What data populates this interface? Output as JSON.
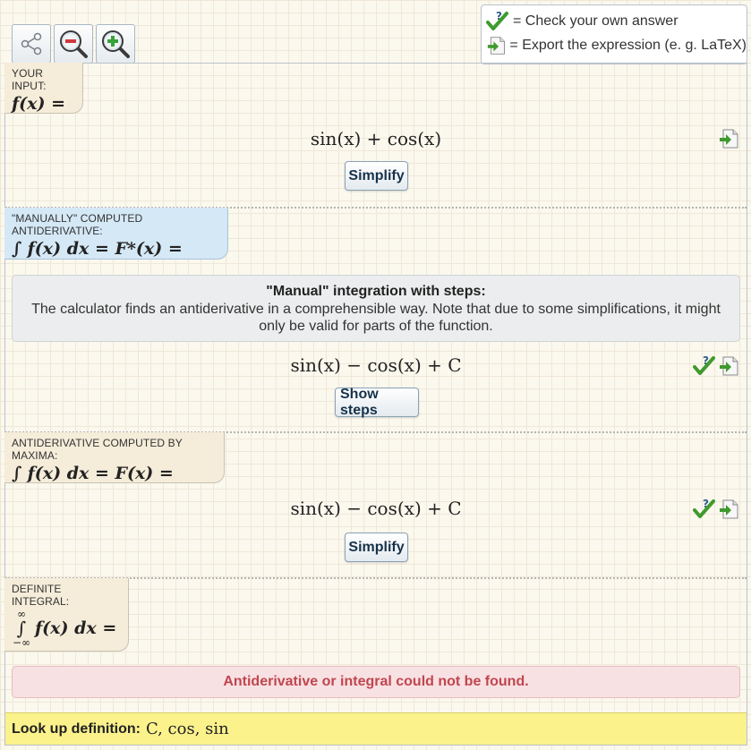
{
  "toolbar": {
    "share_icon": "share-icon",
    "zoom_out_icon": "zoom-out-icon",
    "zoom_in_icon": "zoom-in-icon"
  },
  "legend": {
    "check_text": "= Check your own answer",
    "export_text": "= Export the expression (e. g. LaTeX)"
  },
  "input": {
    "label": "YOUR INPUT:",
    "expr": "f(x) =",
    "result": "sin(x) + cos(x)",
    "button": "Simplify"
  },
  "manual": {
    "label": "\"MANUALLY\" COMPUTED ANTIDERIVATIVE:",
    "expr": "∫ f(x) dx = F*(x) =",
    "info_title": "\"Manual\" integration with steps:",
    "info_text": "The calculator finds an antiderivative in a comprehensible way. Note that due to some simplifications, it might only be valid for parts of the function.",
    "result": "sin(x) − cos(x) + C",
    "button": "Show steps"
  },
  "maxima": {
    "label": "ANTIDERIVATIVE COMPUTED BY MAXIMA:",
    "expr": "∫ f(x) dx = F(x) =",
    "result": "sin(x) − cos(x) + C",
    "button": "Simplify"
  },
  "definite": {
    "label": "DEFINITE INTEGRAL:",
    "upper": "∞",
    "lower": "−∞",
    "expr": "f(x) dx =",
    "error": "Antiderivative or integral could not be found."
  },
  "lookup": {
    "label": "Look up definition:",
    "terms": "C, cos, sin"
  },
  "colors": {
    "check_green": "#3f9a2e",
    "error_red": "#c0464f",
    "lookup_bg": "#fbf28c"
  }
}
